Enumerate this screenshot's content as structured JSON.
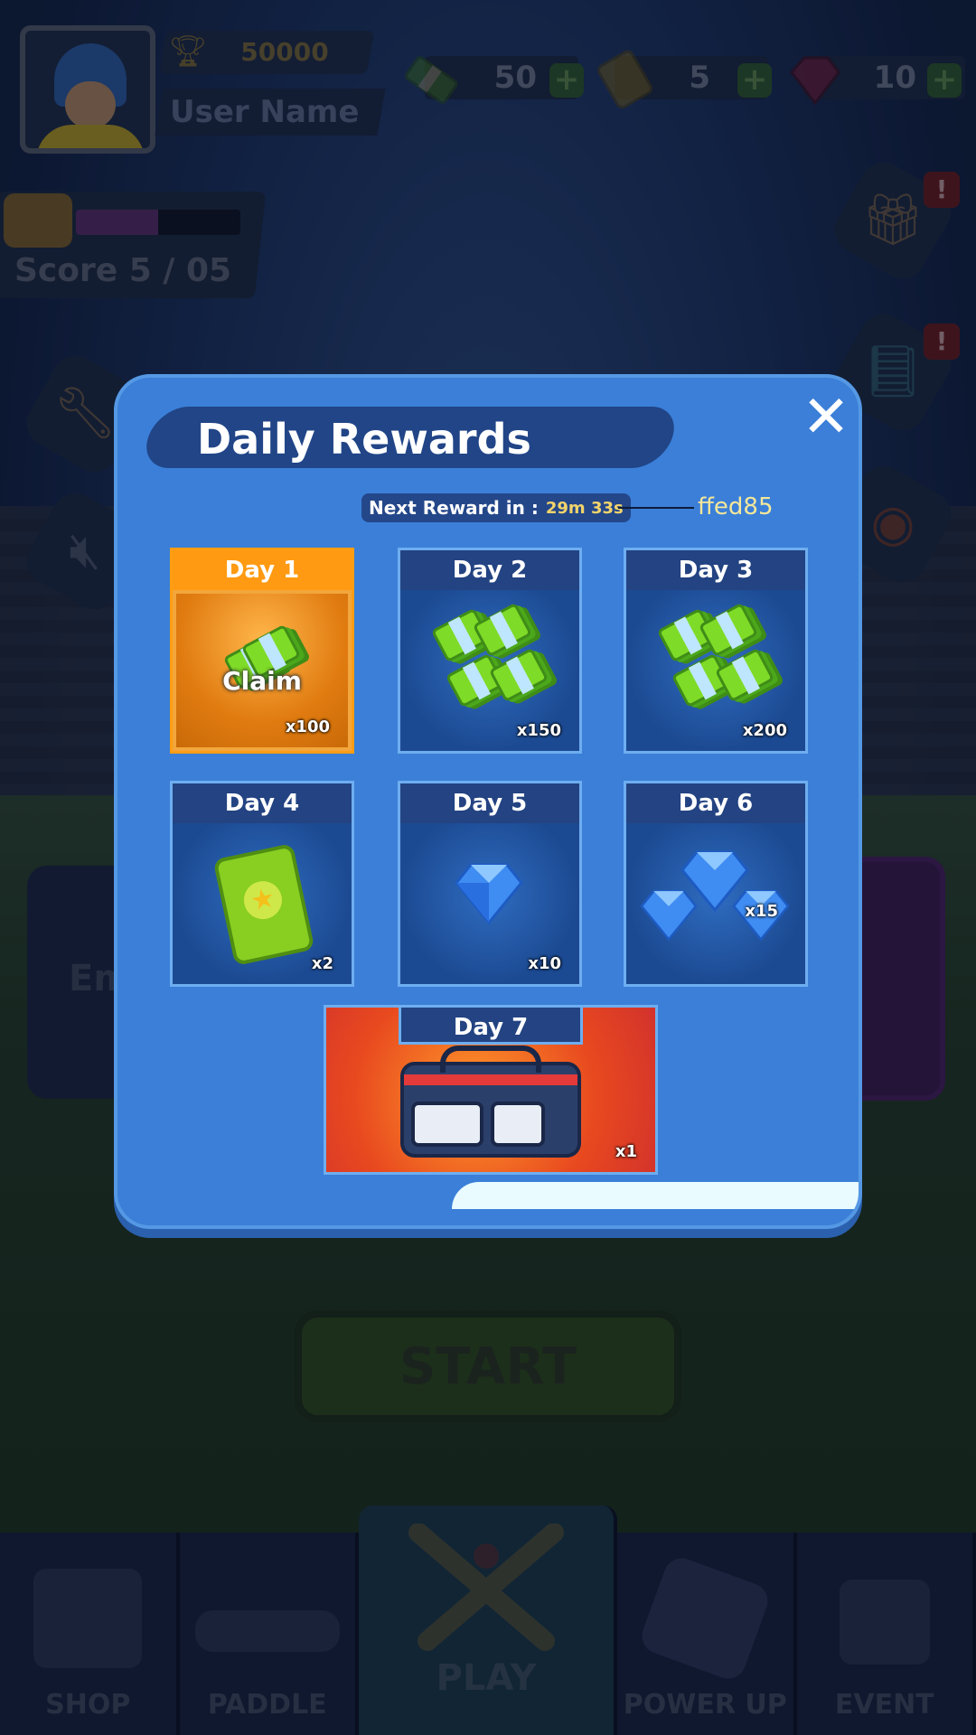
{
  "hud": {
    "trophies": "50000",
    "username": "User Name",
    "resources": [
      {
        "icon": "cash-stack-icon",
        "value": "50"
      },
      {
        "icon": "ticket-icon",
        "value": "5"
      },
      {
        "icon": "gem-icon",
        "value": "10"
      }
    ],
    "score_label": "Score  5 / 05",
    "score_progress": 0.5
  },
  "side": {
    "left_card_text": "Em",
    "alert": "!"
  },
  "start_label": "START",
  "nav": [
    {
      "label": "SHOP",
      "icon": "cart-icon"
    },
    {
      "label": "PADDLE",
      "icon": "paddle-icon"
    },
    {
      "label": "PLAY",
      "icon": "crossed-bats-icon"
    },
    {
      "label": "POWER UP",
      "icon": "power-up-icon"
    },
    {
      "label": "EVENT",
      "icon": "calendar-icon"
    }
  ],
  "dialog": {
    "title": "Daily Rewards",
    "close_glyph": "✕",
    "timer_label": "Next Reward in :",
    "timer_value": "29m 33s",
    "annotation": "ffed85",
    "claim_label": "Claim",
    "days": [
      {
        "label": "Day 1",
        "qty": "x100",
        "reward": "cash",
        "state": "claimable"
      },
      {
        "label": "Day 2",
        "qty": "x150",
        "reward": "cash",
        "state": "locked"
      },
      {
        "label": "Day 3",
        "qty": "x200",
        "reward": "cash",
        "state": "locked"
      },
      {
        "label": "Day 4",
        "qty": "x2",
        "reward": "ticket",
        "state": "locked"
      },
      {
        "label": "Day 5",
        "qty": "x10",
        "reward": "gem",
        "state": "locked"
      },
      {
        "label": "Day 6",
        "qty": "x15",
        "reward": "gems",
        "state": "locked"
      },
      {
        "label": "Day 7",
        "qty": "x1",
        "reward": "kit-bag",
        "state": "locked"
      }
    ]
  },
  "colors": {
    "dialog": "#3b7fd8",
    "title_bar": "#214587",
    "claim_orange": "#ff9a12",
    "timer_text": "#f3d46a",
    "annotation": "#ffed85"
  }
}
